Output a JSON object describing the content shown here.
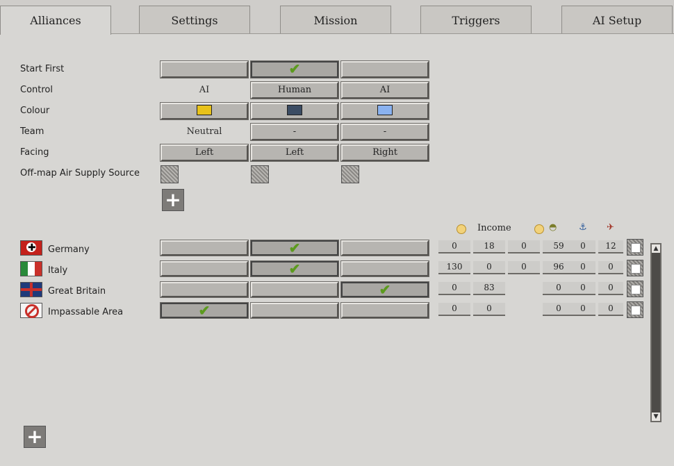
{
  "tabs": [
    {
      "label": "Alliances",
      "active": true
    },
    {
      "label": "Settings",
      "active": false
    },
    {
      "label": "Mission",
      "active": false
    },
    {
      "label": "Triggers",
      "active": false
    },
    {
      "label": "AI Setup",
      "active": false
    }
  ],
  "settings": {
    "start_first": {
      "label": "Start First",
      "checked_index": 1
    },
    "control": {
      "label": "Control",
      "values": [
        "AI",
        "Human",
        "AI"
      ]
    },
    "colour": {
      "label": "Colour",
      "values": [
        "#e8c21a",
        "#3b4c63",
        "#8ab2f0"
      ]
    },
    "team": {
      "label": "Team",
      "values": [
        "Neutral",
        "-",
        "-"
      ]
    },
    "facing": {
      "label": "Facing",
      "values": [
        "Left",
        "Left",
        "Right"
      ]
    },
    "air_supply": {
      "label": "Off-map Air Supply Source"
    }
  },
  "resource_header": {
    "income_label": "Income",
    "icons": [
      "coin-icon",
      "coin-helmet-icon",
      "naval-icon",
      "air-icon"
    ]
  },
  "nations": [
    {
      "name": "Germany",
      "flag": "germany-flag",
      "alliance": 1,
      "values": [
        "0",
        "18",
        "0",
        "59",
        "0",
        "12"
      ]
    },
    {
      "name": "Italy",
      "flag": "italy-flag",
      "alliance": 1,
      "values": [
        "130",
        "0",
        "0",
        "96",
        "0",
        "0"
      ]
    },
    {
      "name": "Great Britain",
      "flag": "great-britain-flag",
      "alliance": 2,
      "values": [
        "0",
        "83",
        "",
        "0",
        "0",
        "0"
      ]
    },
    {
      "name": "Impassable Area",
      "flag": "impassable-icon",
      "alliance": 0,
      "values": [
        "0",
        "0",
        "",
        "0",
        "0",
        "0"
      ]
    }
  ],
  "symbols": {
    "check": "✔",
    "plus": "+",
    "up": "▲",
    "down": "▼"
  }
}
